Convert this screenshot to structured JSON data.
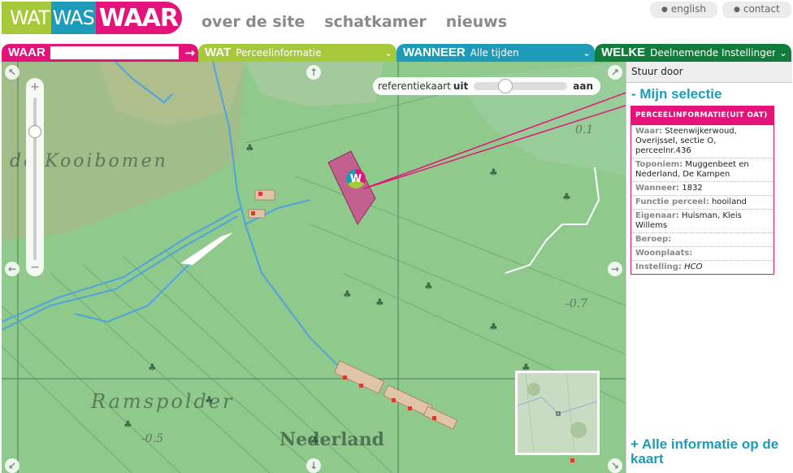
{
  "logo": {
    "part1": "WAT",
    "part2": "WAS",
    "part3": "WAAR"
  },
  "topnav": [
    "over de site",
    "schatkamer",
    "nieuws"
  ],
  "utilnav": [
    "english",
    "contact"
  ],
  "filters": {
    "waar": {
      "label": "WAAR",
      "value": "",
      "go_icon": "arrow-right-icon"
    },
    "wat": {
      "label": "WAT",
      "value": "Perceelinformatie"
    },
    "wanneer": {
      "label": "WANNEER",
      "value": "Alle tijden"
    },
    "welke": {
      "label": "WELKE",
      "value": "Deelnemende Instellingen"
    }
  },
  "map": {
    "reference_toggle": {
      "label": "referentiekaart",
      "off": "uit",
      "on": "aan"
    },
    "labels": [
      "de Kooibomen",
      "Ramspolder",
      "Nederland",
      "-0.5",
      "-0.7",
      "0.1"
    ],
    "marker_letter": "W",
    "zoom_in": "+",
    "zoom_out": "−",
    "pan_arrows": {
      "up": "↑",
      "down": "↓",
      "left": "←",
      "right": "→",
      "nw": "↖",
      "ne": "↗",
      "sw": "↙",
      "se": "↘"
    }
  },
  "sidebar": {
    "send": "Stuur door",
    "selection_title": "- Mijn selectie",
    "card_title": "PERCEELINFORMATIE(UIT OAT)",
    "rows": [
      {
        "key": "Waar:",
        "value": "Steenwijkerwoud, Overijssel, sectie O, perceelnr.436"
      },
      {
        "key": "Toponiem:",
        "value": "Muggenbeet en Nederland, De Kampen"
      },
      {
        "key": "Wanneer:",
        "value": "1832"
      },
      {
        "key": "Functie perceel:",
        "value": "hooiland"
      },
      {
        "key": "Eigenaar:",
        "value": "Huisman, Kleis Willems"
      },
      {
        "key": "Beroep:",
        "value": ""
      },
      {
        "key": "Woonplaats:",
        "value": ""
      },
      {
        "key": "Instelling:",
        "value": "HCO"
      }
    ],
    "all_info": "+ Alle informatie op de kaart"
  },
  "colors": {
    "pink": "#e3137a",
    "lime": "#a5c93a",
    "teal": "#1d9bb8",
    "darkgreen": "#127c3c",
    "map": "#8fc98c"
  }
}
